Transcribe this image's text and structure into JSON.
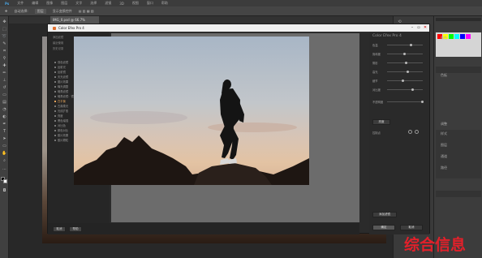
{
  "photoshop": {
    "menubar_items": [
      "Ps",
      "文件",
      "编辑",
      "图像",
      "图层",
      "文字",
      "选择",
      "滤镜",
      "3D",
      "视图",
      "窗口",
      "帮助"
    ],
    "options_items": [
      "✥",
      "自动选择:",
      "图层",
      "显示变换控件"
    ],
    "document_tab": "IMG_0.psd @ 66.7%",
    "right_panel": {
      "rows": [
        "颜色",
        "色板",
        "调整",
        "样式",
        "图层",
        "通道",
        "路径"
      ],
      "swatch_colors": [
        "#ff0000",
        "#ffff00",
        "#00ff00",
        "#00ffff",
        "#0000ff",
        "#ff00ff",
        "#ffffff",
        "#c0c0c0"
      ]
    }
  },
  "plugin": {
    "title": "Color Efex Pro 4",
    "right_title": "Color Efex Pro 4",
    "left_top_items": [
      "添加滤镜",
      "最近使用",
      "历史记录"
    ],
    "left_filters": [
      "双色滤镜",
      "反射光",
      "反射镜",
      "天光滤镜",
      "图片效果",
      "曝光调整",
      "暗角滤镜",
      "暗角滤镜：镜头",
      "白平衡",
      "古典柔光",
      "光线扩散",
      "亮度",
      "黑色增强",
      "对比色",
      "颜色对比",
      "胶片效果",
      "胶片颗粒"
    ],
    "right_sections": [
      "色温",
      "饱和度",
      "阴影",
      "高光",
      "细节",
      "对比度",
      "不透明度"
    ],
    "control_points_label": "控制点",
    "buttons": {
      "brightness_toggle": "亮度",
      "bottom_left": [
        "取消",
        "帮助"
      ],
      "bottom_right": [
        "确定",
        "取消"
      ],
      "add_filter": "添加滤镜"
    }
  },
  "watermark": "综合信息"
}
